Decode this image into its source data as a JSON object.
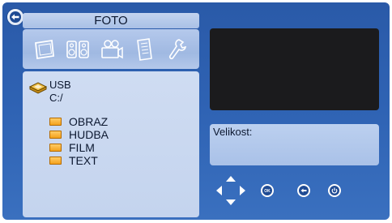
{
  "header": {
    "title": "FOTO",
    "back_icon": "back-arrow-icon"
  },
  "categories": [
    {
      "name": "photo",
      "icon": "photo-frame-icon"
    },
    {
      "name": "music",
      "icon": "speakers-icon"
    },
    {
      "name": "film",
      "icon": "film-camera-icon"
    },
    {
      "name": "text",
      "icon": "document-icon"
    },
    {
      "name": "settings",
      "icon": "wrench-icon"
    }
  ],
  "browser": {
    "drive_name": "USB",
    "drive_path": "C:/",
    "folders": [
      {
        "label": "OBRAZ"
      },
      {
        "label": "HUDBA"
      },
      {
        "label": "FILM"
      },
      {
        "label": "TEXT"
      }
    ]
  },
  "info": {
    "size_label": "Velikost:"
  },
  "controls": {
    "navigate_icon": "dpad-arrows-icon",
    "ok_label": "OK",
    "back_icon": "return-arrow-icon",
    "power_icon": "standby-icon"
  },
  "colors": {
    "background": "#2f63b4",
    "panel": "#c4d4ee",
    "preview": "#1b1b1d",
    "folder": "#f4a21d"
  }
}
